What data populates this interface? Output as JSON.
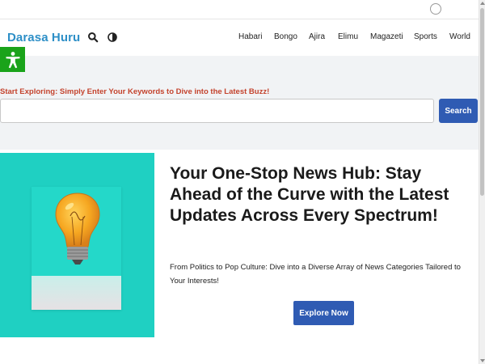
{
  "header": {
    "logo": "Darasa Huru",
    "icons": [
      "search-icon",
      "contrast-icon"
    ],
    "nav": [
      "Habari",
      "Bongo",
      "Ajira",
      "Elimu",
      "Magazeti",
      "Sports",
      "World"
    ]
  },
  "accessibility": {
    "icon": "accessibility-icon"
  },
  "search": {
    "label": "Start Exploring: Simply Enter Your Keywords to Dive into the Latest Buzz!",
    "placeholder": "",
    "button": "Search"
  },
  "hero": {
    "title": "Your One-Stop News Hub: Stay Ahead of the Curve with the Latest Updates Across Every Spectrum!",
    "subtitle": "From Politics to Pop Culture: Dive into a Diverse Array of News Categories Tailored to Your Interests!",
    "button": "Explore Now",
    "image": "lightbulb-image"
  },
  "colors": {
    "brand": "#2d8fc7",
    "button": "#2f5bb3",
    "label": "#c4432d",
    "accessibility": "#1aa31a",
    "hero_image_bg": "#1fd0c2"
  }
}
